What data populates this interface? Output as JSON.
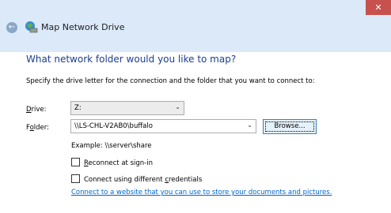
{
  "window": {
    "title": "Map Network Drive",
    "back_icon": "back-arrow-icon",
    "close_icon": "close-icon",
    "app_icon": "network-drive-icon"
  },
  "heading": "What network folder would you like to map?",
  "instructions": "Specify the drive letter for the connection and the folder that you want to connect to:",
  "drive": {
    "label_access": "D",
    "label_rest": "rive:",
    "value": "Z:"
  },
  "folder": {
    "label_first": "F",
    "label_access": "o",
    "label_rest": "lder:",
    "value": "\\\\LS-CHL-V2AB0\\buffalo",
    "browse_label": "Browse..."
  },
  "example": "Example: \\\\server\\share",
  "reconnect": {
    "label_access": "R",
    "label_rest": "econnect at sign-in",
    "checked": false
  },
  "credentials": {
    "label_before": "Connect using different ",
    "label_access": "c",
    "label_rest": "redentials",
    "checked": false
  },
  "link": "Connect to a website that you can use to store your documents and pictures.",
  "colors": {
    "titlebar": "#dbe9f8",
    "heading": "#1b3f8f",
    "link": "#0066cc",
    "close": "#c7514d"
  }
}
